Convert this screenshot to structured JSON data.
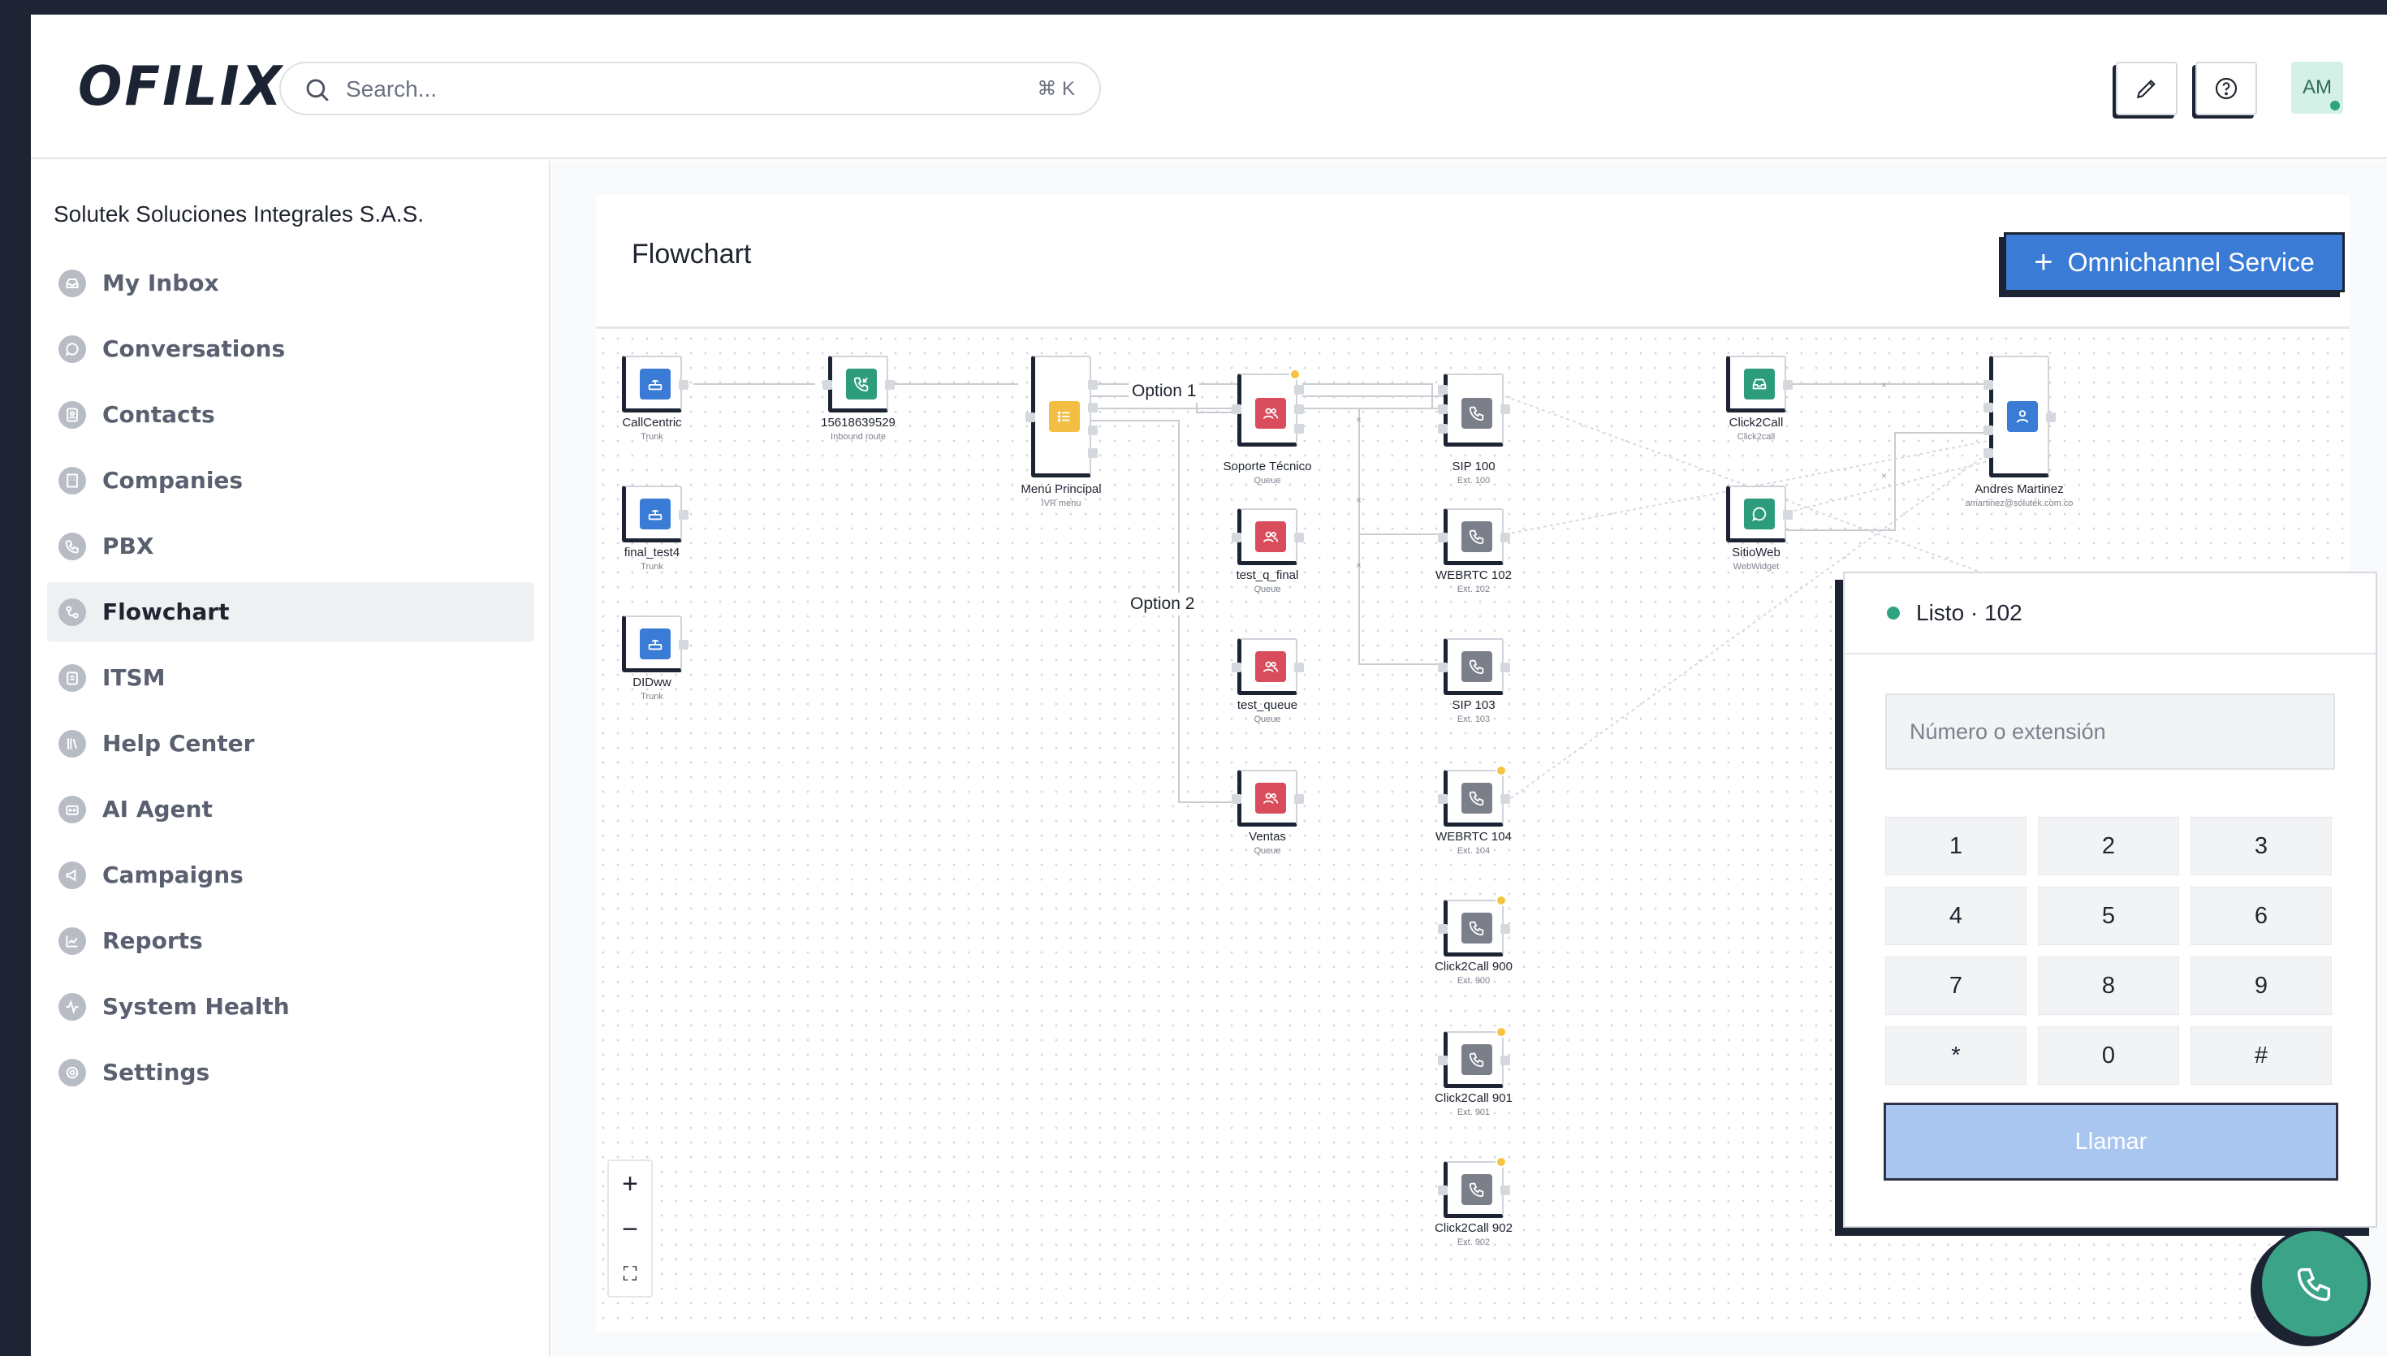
{
  "app": {
    "logo": "OFILIX"
  },
  "search": {
    "placeholder": "Search...",
    "shortcut": "⌘ K"
  },
  "user": {
    "initials": "AM"
  },
  "sidebar": {
    "org_name": "Solutek Soluciones Integrales S.A.S.",
    "items": [
      {
        "label": "My Inbox",
        "icon": "inbox-icon"
      },
      {
        "label": "Conversations",
        "icon": "chat-icon"
      },
      {
        "label": "Contacts",
        "icon": "contacts-icon"
      },
      {
        "label": "Companies",
        "icon": "building-icon"
      },
      {
        "label": "PBX",
        "icon": "phone-icon"
      },
      {
        "label": "Flowchart",
        "icon": "flowchart-icon",
        "active": true
      },
      {
        "label": "ITSM",
        "icon": "clipboard-icon"
      },
      {
        "label": "Help Center",
        "icon": "book-icon"
      },
      {
        "label": "AI Agent",
        "icon": "bot-icon"
      },
      {
        "label": "Campaigns",
        "icon": "megaphone-icon"
      },
      {
        "label": "Reports",
        "icon": "chart-icon"
      },
      {
        "label": "System Health",
        "icon": "activity-icon"
      },
      {
        "label": "Settings",
        "icon": "gear-icon"
      }
    ]
  },
  "page": {
    "title": "Flowchart",
    "primary_button": "Omnichannel Service"
  },
  "flow": {
    "nodes": {
      "callcentric": {
        "label": "CallCentric",
        "sub": "Trunk"
      },
      "final_test4": {
        "label": "final_test4",
        "sub": "Trunk"
      },
      "didww": {
        "label": "DIDww",
        "sub": "Trunk"
      },
      "inbound": {
        "label": "15618639529",
        "sub": "Inbound route"
      },
      "menu": {
        "label": "Menú Principal",
        "sub": "IVR menu"
      },
      "soporte": {
        "label": "Soporte Técnico",
        "sub": "Queue"
      },
      "test_q_final": {
        "label": "test_q_final",
        "sub": "Queue"
      },
      "test_queue": {
        "label": "test_queue",
        "sub": "Queue"
      },
      "ventas": {
        "label": "Ventas",
        "sub": "Queue"
      },
      "sip100": {
        "label": "SIP 100",
        "sub": "Ext. 100"
      },
      "webrtc102": {
        "label": "WEBRTC 102",
        "sub": "Ext. 102"
      },
      "sip103": {
        "label": "SIP 103",
        "sub": "Ext. 103"
      },
      "webrtc104": {
        "label": "WEBRTC 104",
        "sub": "Ext. 104"
      },
      "c2c900": {
        "label": "Click2Call 900",
        "sub": "Ext. 900"
      },
      "c2c901": {
        "label": "Click2Call 901",
        "sub": "Ext. 901"
      },
      "c2c902": {
        "label": "Click2Call 902",
        "sub": "Ext. 902"
      },
      "click2call": {
        "label": "Click2Call",
        "sub": "Click2call"
      },
      "sitioweb": {
        "label": "SitioWeb",
        "sub": "WebWidget"
      },
      "andres": {
        "label": "Andres Martinez",
        "sub": "amartinez@solutek.com.co"
      }
    },
    "edge_labels": {
      "option1": "Option 1",
      "option2": "Option 2"
    },
    "zoom": {
      "in": "+",
      "out": "−",
      "fit": "⛶"
    }
  },
  "dialer": {
    "status": "Listo · 102",
    "status_color": "#2ea37f",
    "placeholder": "Número o extensión",
    "keys": [
      "1",
      "2",
      "3",
      "4",
      "5",
      "6",
      "7",
      "8",
      "9",
      "*",
      "0",
      "#"
    ],
    "call_label": "Llamar"
  },
  "colors": {
    "accent": "#3a7bd5",
    "queue": "#d94c5c",
    "extension": "#7a7f89",
    "ivr": "#f2be43",
    "inbound": "#2d9c7c",
    "success": "#2ea37f"
  }
}
